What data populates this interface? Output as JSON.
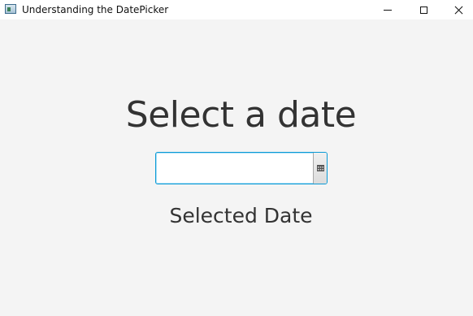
{
  "window": {
    "title": "Understanding the DatePicker",
    "controls": [
      "minimize",
      "maximize",
      "close"
    ]
  },
  "main": {
    "heading": "Select a date",
    "datepicker": {
      "value": "",
      "placeholder": "",
      "button_icon": "calendar-icon"
    },
    "selected_label": "Selected Date"
  },
  "colors": {
    "focus_border": "#0a9ad6",
    "background": "#f4f4f4",
    "text": "#333333"
  }
}
